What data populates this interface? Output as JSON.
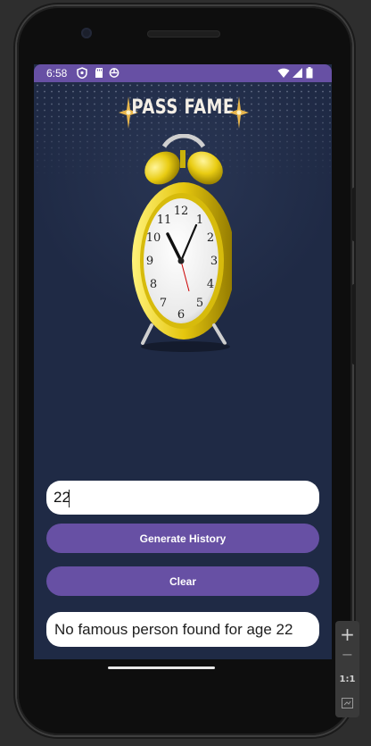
{
  "status_bar": {
    "time": "6:58",
    "icons": [
      "shield-icon",
      "sd-card-icon",
      "sync-icon",
      "wifi-icon",
      "cell-signal-icon",
      "battery-icon"
    ]
  },
  "header": {
    "brand_title": "PASS FAME"
  },
  "form": {
    "age_value": "22",
    "generate_label": "Generate History",
    "clear_label": "Clear"
  },
  "result": {
    "text": "No famous person found for age 22"
  },
  "emulator_controls": {
    "zoom_in": "+",
    "zoom_out": "−",
    "actual_size": "1:1"
  },
  "colors": {
    "accent": "#6750a4",
    "background": "#1f2a45",
    "field": "#ffffff",
    "clock": "#f2d21c"
  }
}
